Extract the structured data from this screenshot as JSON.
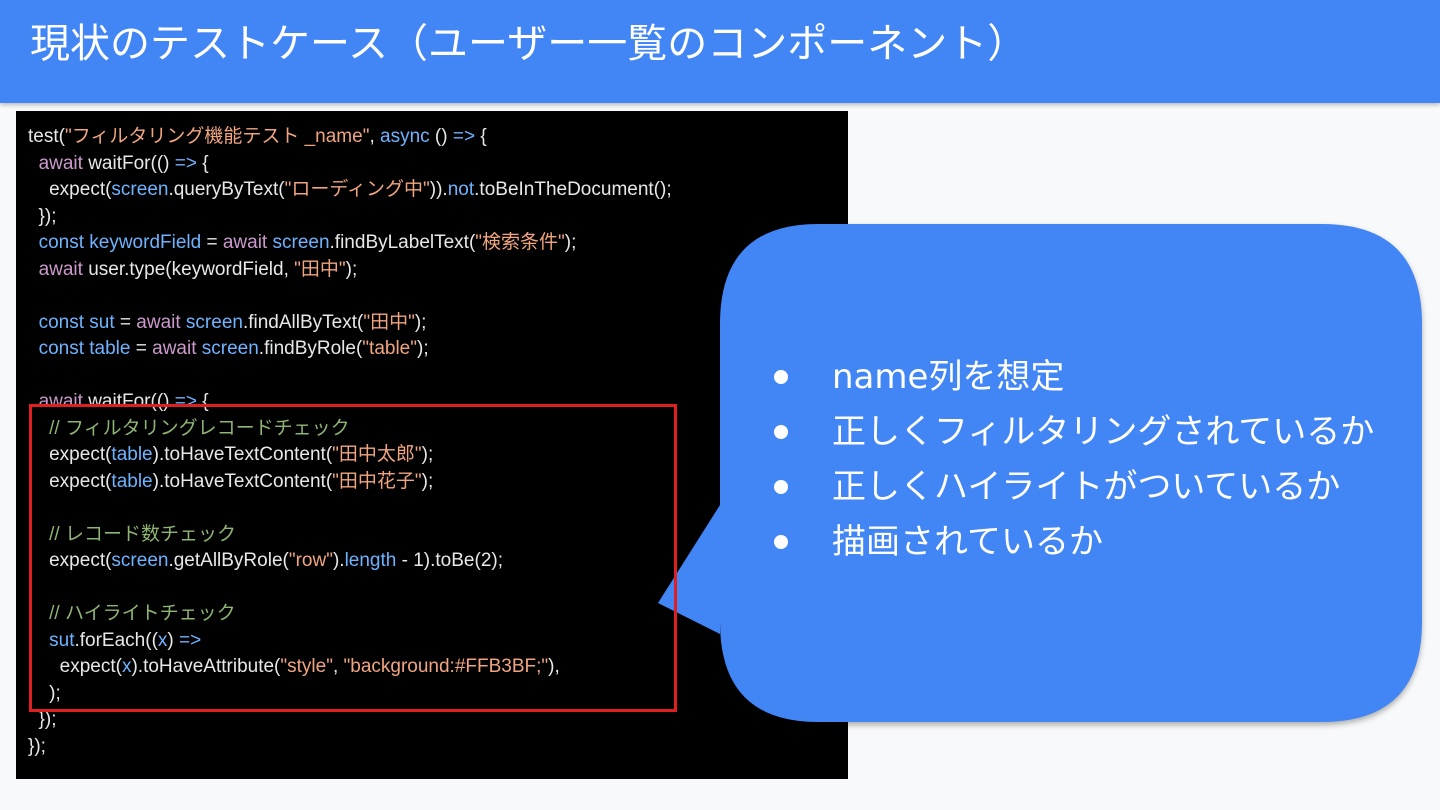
{
  "slide": {
    "title": "現状のテストケース（ユーザー一覧のコンポーネント）"
  },
  "code": {
    "lines": [
      [
        [
          "p",
          "test("
        ],
        [
          "s",
          "\"フィルタリング機能テスト _name\""
        ],
        [
          "p",
          ", "
        ],
        [
          "v",
          "async"
        ],
        [
          "p",
          " () "
        ],
        [
          "v",
          "=>"
        ],
        [
          "p",
          " {"
        ]
      ],
      [
        [
          "p",
          "  "
        ],
        [
          "k",
          "await"
        ],
        [
          "p",
          " waitFor(() "
        ],
        [
          "v",
          "=>"
        ],
        [
          "p",
          " {"
        ]
      ],
      [
        [
          "p",
          "    expect("
        ],
        [
          "v",
          "screen"
        ],
        [
          "p",
          ".queryByText("
        ],
        [
          "s",
          "\"ローディング中\""
        ],
        [
          "p",
          "))."
        ],
        [
          "v",
          "not"
        ],
        [
          "p",
          ".toBeInTheDocument();"
        ]
      ],
      [
        [
          "p",
          "  });"
        ]
      ],
      [
        [
          "p",
          "  "
        ],
        [
          "v",
          "const"
        ],
        [
          "p",
          " "
        ],
        [
          "v",
          "keywordField"
        ],
        [
          "p",
          " = "
        ],
        [
          "k",
          "await"
        ],
        [
          "p",
          " "
        ],
        [
          "v",
          "screen"
        ],
        [
          "p",
          ".findByLabelText("
        ],
        [
          "s",
          "\"検索条件\""
        ],
        [
          "p",
          ");"
        ]
      ],
      [
        [
          "p",
          "  "
        ],
        [
          "k",
          "await"
        ],
        [
          "p",
          " user.type(keywordField, "
        ],
        [
          "s",
          "\"田中\""
        ],
        [
          "p",
          ");"
        ]
      ],
      [],
      [
        [
          "p",
          "  "
        ],
        [
          "v",
          "const"
        ],
        [
          "p",
          " "
        ],
        [
          "v",
          "sut"
        ],
        [
          "p",
          " = "
        ],
        [
          "k",
          "await"
        ],
        [
          "p",
          " "
        ],
        [
          "v",
          "screen"
        ],
        [
          "p",
          ".findAllByText("
        ],
        [
          "s",
          "\"田中\""
        ],
        [
          "p",
          ");"
        ]
      ],
      [
        [
          "p",
          "  "
        ],
        [
          "v",
          "const"
        ],
        [
          "p",
          " "
        ],
        [
          "v",
          "table"
        ],
        [
          "p",
          " = "
        ],
        [
          "k",
          "await"
        ],
        [
          "p",
          " "
        ],
        [
          "v",
          "screen"
        ],
        [
          "p",
          ".findByRole("
        ],
        [
          "s",
          "\"table\""
        ],
        [
          "p",
          ");"
        ]
      ],
      [],
      [
        [
          "p",
          "  "
        ],
        [
          "k",
          "await"
        ],
        [
          "p",
          " waitFor(() "
        ],
        [
          "v",
          "=>"
        ],
        [
          "p",
          " {"
        ]
      ],
      [
        [
          "p",
          "    "
        ],
        [
          "c",
          "// フィルタリングレコードチェック"
        ]
      ],
      [
        [
          "p",
          "    expect("
        ],
        [
          "v",
          "table"
        ],
        [
          "p",
          ").toHaveTextContent("
        ],
        [
          "s",
          "\"田中太郎\""
        ],
        [
          "p",
          ");"
        ]
      ],
      [
        [
          "p",
          "    expect("
        ],
        [
          "v",
          "table"
        ],
        [
          "p",
          ").toHaveTextContent("
        ],
        [
          "s",
          "\"田中花子\""
        ],
        [
          "p",
          ");"
        ]
      ],
      [],
      [
        [
          "p",
          "    "
        ],
        [
          "c",
          "// レコード数チェック"
        ]
      ],
      [
        [
          "p",
          "    expect("
        ],
        [
          "v",
          "screen"
        ],
        [
          "p",
          ".getAllByRole("
        ],
        [
          "s",
          "\"row\""
        ],
        [
          "p",
          ")."
        ],
        [
          "v",
          "length"
        ],
        [
          "p",
          " - 1).toBe(2);"
        ]
      ],
      [],
      [
        [
          "p",
          "    "
        ],
        [
          "c",
          "// ハイライトチェック"
        ]
      ],
      [
        [
          "p",
          "    "
        ],
        [
          "v",
          "sut"
        ],
        [
          "p",
          ".forEach(("
        ],
        [
          "v",
          "x"
        ],
        [
          "p",
          ") "
        ],
        [
          "v",
          "=>"
        ]
      ],
      [
        [
          "p",
          "      expect("
        ],
        [
          "v",
          "x"
        ],
        [
          "p",
          ").toHaveAttribute("
        ],
        [
          "s",
          "\"style\""
        ],
        [
          "p",
          ", "
        ],
        [
          "s",
          "\"background:#FFB3BF;\""
        ],
        [
          "p",
          "),"
        ]
      ],
      [
        [
          "p",
          "    );"
        ]
      ],
      [
        [
          "p",
          "  });"
        ]
      ],
      [
        [
          "p",
          "});"
        ]
      ]
    ]
  },
  "callout": {
    "bullets": [
      "name列を想定",
      "正しくフィルタリングされているか",
      "正しくハイライトがついているか",
      "描画されているか"
    ]
  },
  "colors": {
    "header": "#4285f4",
    "callout": "#4285f4",
    "highlight": "#e02020"
  }
}
